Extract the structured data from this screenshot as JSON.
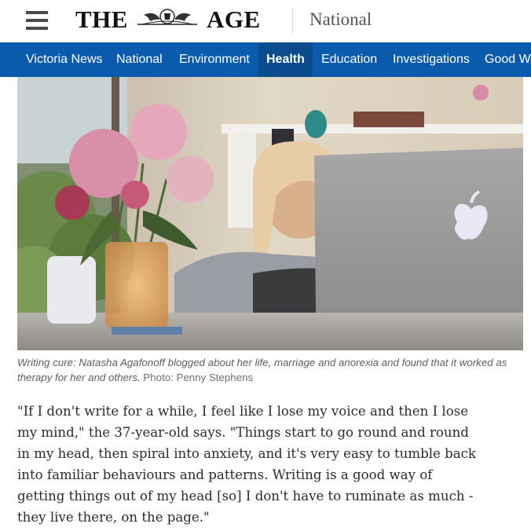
{
  "header": {
    "logo_left": "THE",
    "logo_right": "AGE",
    "section": "National"
  },
  "nav": {
    "items": [
      "Victoria News",
      "National",
      "Environment",
      "Health",
      "Education",
      "Investigations",
      "Good We"
    ],
    "active": "Health"
  },
  "photo": {
    "caption": "Writing cure: Natasha Agafonoff blogged about her life, marriage and anorexia and found that it worked as therapy for her and others.",
    "credit": "Photo: Penny Stephens"
  },
  "article": {
    "lines": [
      "\"If I don't write for a while, I feel like I lose my voice and then I lose",
      "my mind,\" the 37-year-old says. \"Things start to go round and round",
      "in my head, then spiral into anxiety, and it's very easy to tumble back",
      "into familiar behaviours and patterns. Writing is a good way of",
      "getting things out of my head [so] I don't have to ruminate as much -",
      "they live there, on the page.\""
    ]
  },
  "colors": {
    "nav_bg": "#0a5bad",
    "nav_active_bg": "#0b4c8e"
  }
}
